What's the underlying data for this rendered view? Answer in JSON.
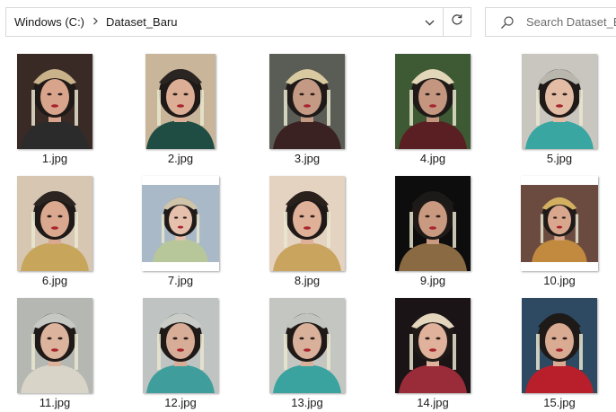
{
  "address": {
    "root": "Windows (C:)",
    "folder": "Dataset_Baru"
  },
  "search": {
    "placeholder": "Search Dataset_Baru"
  },
  "icons": {
    "breadcrumb_separator": "chevron-right-icon",
    "address_dropdown": "chevron-down-icon",
    "refresh": "refresh-icon",
    "search": "search-icon"
  },
  "files": [
    {
      "name": "1.jpg",
      "bg": "#3a2a26",
      "skin": "#d9a48c",
      "crown": "#c9b28a",
      "outfit": "#2b2b2b"
    },
    {
      "name": "2.jpg",
      "bg": "#c8b59a",
      "skin": "#dcae95",
      "crown": "#2a2523",
      "outfit": "#1f4d43"
    },
    {
      "name": "3.jpg",
      "bg": "#5a5d55",
      "skin": "#c49a84",
      "crown": "#d8c9a0",
      "outfit": "#3b2222"
    },
    {
      "name": "4.jpg",
      "bg": "#3d5a34",
      "skin": "#c49680",
      "crown": "#e2d7b8",
      "outfit": "#5a1f22"
    },
    {
      "name": "5.jpg",
      "bg": "#c9c6c0",
      "skin": "#e3bca5",
      "crown": "#b8b6ad",
      "outfit": "#39a6a2"
    },
    {
      "name": "6.jpg",
      "bg": "#d6c6b2",
      "skin": "#d9a88e",
      "crown": "#2c2420",
      "outfit": "#c7a55a"
    },
    {
      "name": "7.jpg",
      "bg": "#a9b9c7",
      "skin": "#e5c0ad",
      "crown": "#cfc4aa",
      "outfit": "#b8c79a"
    },
    {
      "name": "8.jpg",
      "bg": "#e4d3c0",
      "skin": "#dfb198",
      "crown": "#2b211c",
      "outfit": "#c9a45f"
    },
    {
      "name": "9.jpg",
      "bg": "#0d0d0d",
      "skin": "#c99a80",
      "crown": "#1c1a18",
      "outfit": "#8a6a42"
    },
    {
      "name": "10.jpg",
      "bg": "#6b4a3f",
      "skin": "#d9a78e",
      "crown": "#d2b060",
      "outfit": "#c18a3e"
    },
    {
      "name": "11.jpg",
      "bg": "#b5b8b2",
      "skin": "#dcb39d",
      "crown": "#c6c8c4",
      "outfit": "#d8d4c8"
    },
    {
      "name": "12.jpg",
      "bg": "#bfc4c2",
      "skin": "#d8ad97",
      "crown": "#c9ccc7",
      "outfit": "#3f9e9b"
    },
    {
      "name": "13.jpg",
      "bg": "#c4c6c2",
      "skin": "#d9b19b",
      "crown": "#c2c5bf",
      "outfit": "#3aa39f"
    },
    {
      "name": "14.jpg",
      "bg": "#1a1416",
      "skin": "#e0b29b",
      "crown": "#e3d6bd",
      "outfit": "#9a2c3a"
    },
    {
      "name": "15.jpg",
      "bg": "#2e4a63",
      "skin": "#d9ab92",
      "crown": "#1e1a18",
      "outfit": "#b81f2a"
    }
  ]
}
